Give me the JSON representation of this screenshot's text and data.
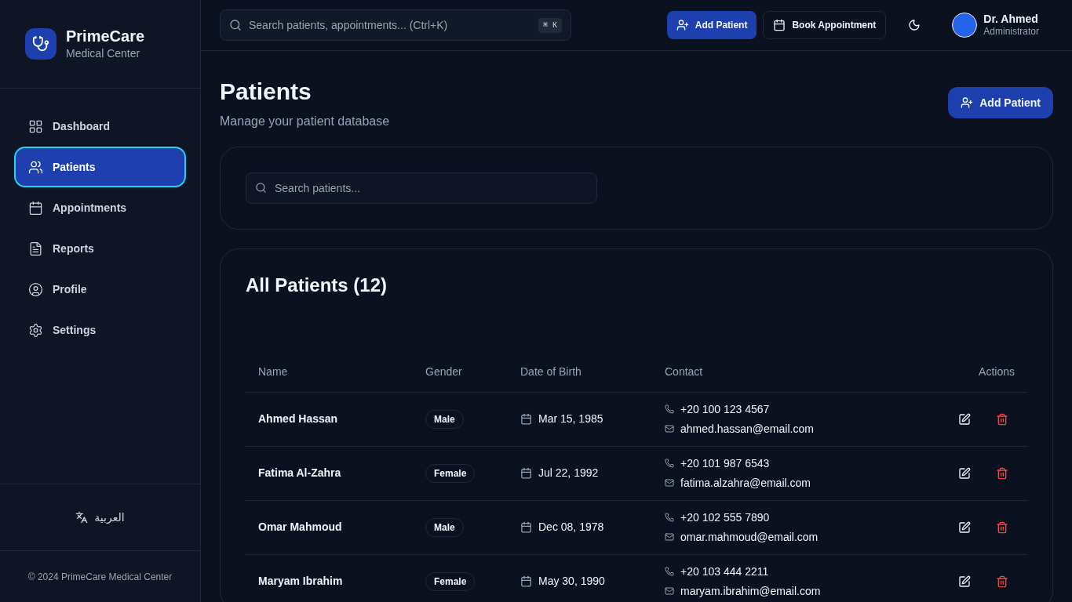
{
  "brand": {
    "name": "PrimeCare",
    "subtitle": "Medical Center"
  },
  "sidebar": {
    "items": [
      {
        "kind": "dashboard",
        "label": "Dashboard",
        "selected": false
      },
      {
        "kind": "patients",
        "label": "Patients",
        "selected": true
      },
      {
        "kind": "appointments",
        "label": "Appointments",
        "selected": false
      },
      {
        "kind": "reports",
        "label": "Reports",
        "selected": false
      },
      {
        "kind": "profile",
        "label": "Profile",
        "selected": false
      },
      {
        "kind": "settings",
        "label": "Settings",
        "selected": false
      }
    ],
    "language": "العربية",
    "footer": "© 2024 PrimeCare Medical Center"
  },
  "topbar": {
    "search": {
      "placeholder": "Search patients, appointments... (Ctrl+K)",
      "shortcut": "⌘ K"
    },
    "add_patient": "Add Patient",
    "book_appointment": "Book Appointment",
    "user": {
      "name": "Dr. Ahmed",
      "role": "Administrator"
    }
  },
  "page": {
    "title": "Patients",
    "subtitle": "Manage your patient database",
    "add_patient": "Add Patient"
  },
  "filter": {
    "search": {
      "placeholder": "Search patients..."
    }
  },
  "table": {
    "title": "All Patients (12)",
    "columns": [
      "Name",
      "Gender",
      "Date of Birth",
      "Contact",
      "Actions"
    ],
    "rows": [
      {
        "name": "Ahmed Hassan",
        "gender": "Male",
        "dob": "Mar 15, 1985",
        "phone": "+20 100 123 4567",
        "email": "ahmed.hassan@email.com"
      },
      {
        "name": "Fatima Al-Zahra",
        "gender": "Female",
        "dob": "Jul 22, 1992",
        "phone": "+20 101 987 6543",
        "email": "fatima.alzahra@email.com"
      },
      {
        "name": "Omar Mahmoud",
        "gender": "Male",
        "dob": "Dec 08, 1978",
        "phone": "+20 102 555 7890",
        "email": "omar.mahmoud@email.com"
      },
      {
        "name": "Maryam Ibrahim",
        "gender": "Female",
        "dob": "May 30, 1990",
        "phone": "+20 103 444 2211",
        "email": "maryam.ibrahim@email.com"
      }
    ]
  }
}
